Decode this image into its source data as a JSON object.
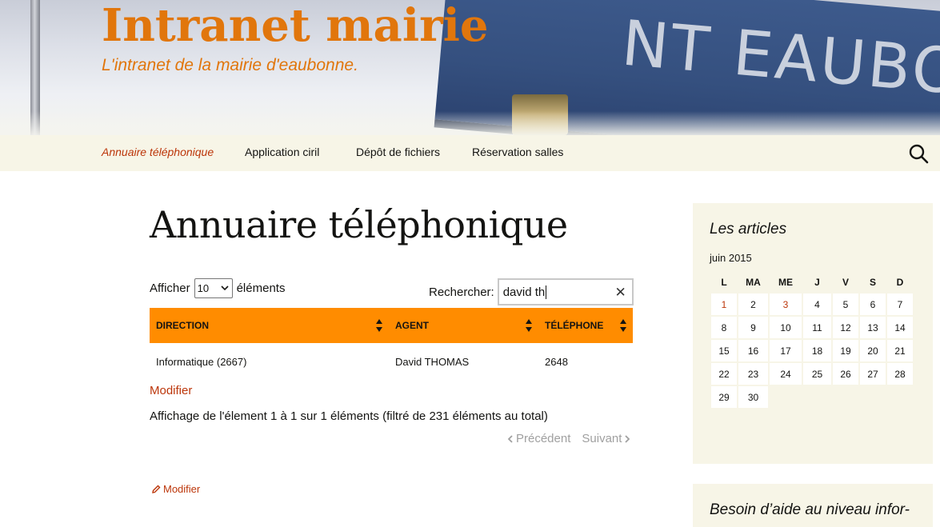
{
  "header": {
    "site_title": "Intranet mairie",
    "site_description": "L'intranet de la mairie d'eaubonne.",
    "sign_text": "NT EAUBONN"
  },
  "nav": {
    "items": [
      {
        "label": "Annuaire téléphonique",
        "active": true
      },
      {
        "label": "Application ciril",
        "active": false
      },
      {
        "label": "Dépôt de fichiers",
        "active": false
      },
      {
        "label": "Réservation salles",
        "active": false
      }
    ],
    "search_icon": "search-icon"
  },
  "page": {
    "title": "Annuaire téléphonique",
    "length_prefix": "Afficher",
    "length_value": "10",
    "length_suffix": "éléments",
    "search_label": "Rechercher:",
    "search_value": "david th",
    "table": {
      "columns": [
        "DIRECTION",
        "AGENT",
        "TÉLÉPHONE"
      ],
      "rows": [
        [
          "Informatique (2667)",
          "David THOMAS",
          "2648"
        ]
      ]
    },
    "modifier_label": "Modifier",
    "info": "Affichage de l'élement 1 à 1 sur 1 éléments (filtré de 231 éléments au total)",
    "prev_label": "Précédent",
    "next_label": "Suivant",
    "edit_label": "Modifier"
  },
  "sidebar": {
    "articles_title": "Les articles",
    "calendar": {
      "caption": "juin 2015",
      "headers": [
        "L",
        "MA",
        "ME",
        "J",
        "V",
        "S",
        "D"
      ],
      "weeks": [
        [
          "1",
          "2",
          "3",
          "4",
          "5",
          "6",
          "7"
        ],
        [
          "8",
          "9",
          "10",
          "11",
          "12",
          "13",
          "14"
        ],
        [
          "15",
          "16",
          "17",
          "18",
          "19",
          "20",
          "21"
        ],
        [
          "22",
          "23",
          "24",
          "25",
          "26",
          "27",
          "28"
        ],
        [
          "29",
          "30",
          "",
          "",
          "",
          "",
          ""
        ]
      ],
      "linked_days": [
        "1",
        "3"
      ]
    },
    "help_title": "Besoin d’aide au niveau infor-"
  },
  "colors": {
    "accent": "#e1760c",
    "link": "#bc360a",
    "table_header": "#ff8c00",
    "nav_bg": "#f7f5e7"
  }
}
